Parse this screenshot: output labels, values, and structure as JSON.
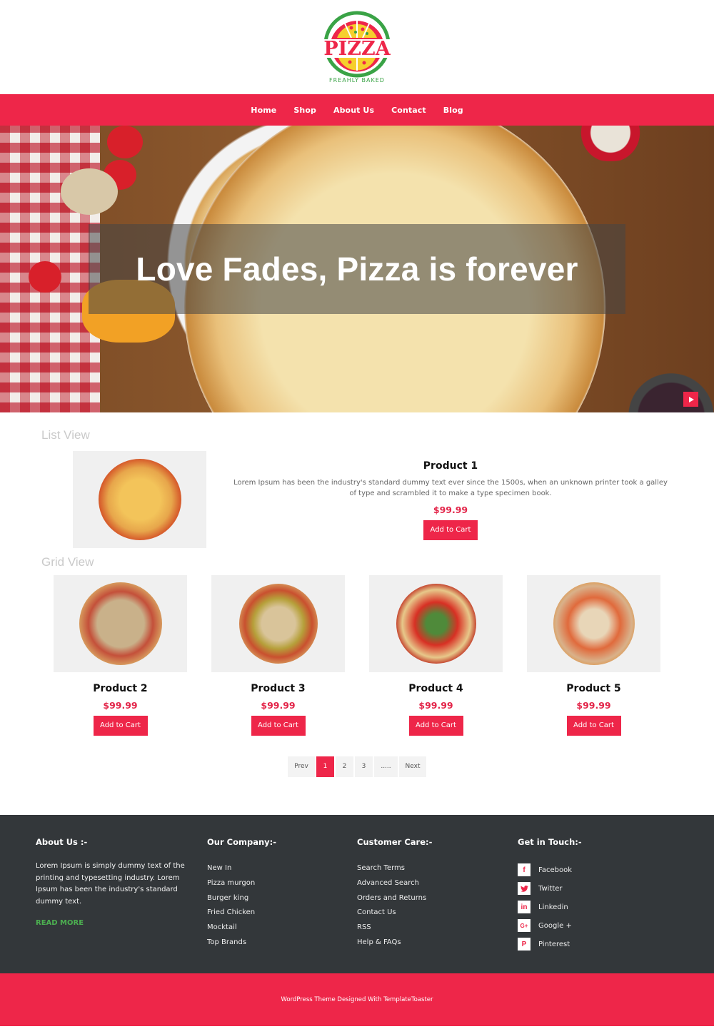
{
  "brand": {
    "logo_text": "PIZZA",
    "logo_tagline": "FREAHLY BAKED",
    "colors": {
      "primary": "#ee2649",
      "green": "#4caf50",
      "footer_bg": "#33373a"
    }
  },
  "nav": {
    "items": [
      {
        "label": "Home"
      },
      {
        "label": "Shop"
      },
      {
        "label": "About Us"
      },
      {
        "label": "Contact"
      },
      {
        "label": "Blog"
      }
    ]
  },
  "hero": {
    "title": "Love Fades, Pizza is forever",
    "play_icon": "play-icon"
  },
  "list_view": {
    "label": "List View",
    "items": [
      {
        "title": "Product 1",
        "description": "Lorem Ipsum has been the industry's standard dummy text ever since the 1500s, when an unknown printer took a galley of type and scrambled it to make a type specimen book.",
        "price": "$99.99",
        "button": "Add to Cart"
      }
    ]
  },
  "grid_view": {
    "label": "Grid View",
    "items": [
      {
        "title": "Product 2",
        "price": "$99.99",
        "button": "Add to Cart"
      },
      {
        "title": "Product 3",
        "price": "$99.99",
        "button": "Add to Cart"
      },
      {
        "title": "Product 4",
        "price": "$99.99",
        "button": "Add to Cart"
      },
      {
        "title": "Product 5",
        "price": "$99.99",
        "button": "Add to Cart"
      }
    ]
  },
  "pagination": {
    "prev": "Prev",
    "pages": [
      "1",
      "2",
      "3",
      "....."
    ],
    "next": "Next",
    "current": "1"
  },
  "footer": {
    "about": {
      "heading": "About Us :-",
      "text": "Lorem Ipsum is simply dummy text of the printing and typesetting industry. Lorem Ipsum has been the industry's standard dummy text.",
      "read_more": "READ MORE"
    },
    "company": {
      "heading": "Our Company:-",
      "links": [
        "New In",
        "Pizza murgon",
        "Burger king",
        "Fried Chicken",
        "Mocktail",
        "Top Brands"
      ]
    },
    "care": {
      "heading": "Customer Care:-",
      "links": [
        "Search Terms",
        "Advanced Search",
        "Orders and Returns",
        "Contact Us",
        "RSS",
        "Help & FAQs"
      ]
    },
    "touch": {
      "heading": "Get in Touch:-",
      "social": [
        {
          "label": "Facebook",
          "icon": "facebook-icon",
          "glyph": "f"
        },
        {
          "label": "Twitter",
          "icon": "twitter-icon",
          "glyph": "🐦"
        },
        {
          "label": "Linkedin",
          "icon": "linkedin-icon",
          "glyph": "in"
        },
        {
          "label": "Google +",
          "icon": "google-plus-icon",
          "glyph": "G+"
        },
        {
          "label": "Pinterest",
          "icon": "pinterest-icon",
          "glyph": "P"
        }
      ]
    },
    "credit": "WordPress Theme Designed With TemplateToaster"
  }
}
